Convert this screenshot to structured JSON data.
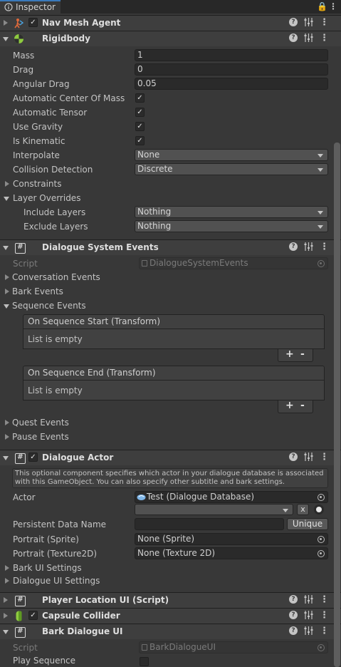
{
  "window": {
    "tab_label": "Inspector"
  },
  "components": {
    "nav_mesh_agent": {
      "title": "Nav Mesh Agent"
    },
    "rigidbody": {
      "title": "Rigidbody",
      "mass_label": "Mass",
      "mass_value": "1",
      "drag_label": "Drag",
      "drag_value": "0",
      "angular_drag_label": "Angular Drag",
      "angular_drag_value": "0.05",
      "auto_center_label": "Automatic Center Of Mass",
      "auto_tensor_label": "Automatic Tensor",
      "use_gravity_label": "Use Gravity",
      "is_kinematic_label": "Is Kinematic",
      "interpolate_label": "Interpolate",
      "interpolate_value": "None",
      "collision_label": "Collision Detection",
      "collision_value": "Discrete",
      "constraints_label": "Constraints",
      "layer_overrides_label": "Layer Overrides",
      "include_layers_label": "Include Layers",
      "include_layers_value": "Nothing",
      "exclude_layers_label": "Exclude Layers",
      "exclude_layers_value": "Nothing"
    },
    "dialogue_system_events": {
      "title": "Dialogue System Events",
      "script_label": "Script",
      "script_value": "DialogueSystemEvents",
      "conversation_events": "Conversation Events",
      "bark_events": "Bark Events",
      "sequence_events": "Sequence Events",
      "on_start_title": "On Sequence Start (Transform)",
      "on_end_title": "On Sequence End (Transform)",
      "list_empty": "List is empty",
      "plus": "+",
      "minus": "-",
      "quest_events": "Quest Events",
      "pause_events": "Pause Events"
    },
    "dialogue_actor": {
      "title": "Dialogue Actor",
      "help_text": "This optional component specifies which actor in your dialogue database is associated with this GameObject. You can also specify other subtitle and bark settings.",
      "actor_label": "Actor",
      "actor_value": "Test (Dialogue Database)",
      "clear_label": "x",
      "persistent_label": "Persistent Data Name",
      "persistent_value": "",
      "unique_button": "Unique",
      "portrait_sprite_label": "Portrait (Sprite)",
      "portrait_sprite_value": "None (Sprite)",
      "portrait_tex_label": "Portrait (Texture2D)",
      "portrait_tex_value": "None (Texture 2D)",
      "bark_ui_settings": "Bark UI Settings",
      "dialogue_ui_settings": "Dialogue UI Settings"
    },
    "player_location_ui": {
      "title": "Player Location UI (Script)"
    },
    "capsule_collider": {
      "title": "Capsule Collider"
    },
    "bark_dialogue_ui": {
      "title": "Bark Dialogue UI",
      "script_label": "Script",
      "script_value": "BarkDialogueUI",
      "play_sequence_label": "Play Sequence"
    }
  },
  "colors": {
    "accent": "#3a79bb",
    "background": "#383838",
    "header": "#3e3e3e"
  }
}
